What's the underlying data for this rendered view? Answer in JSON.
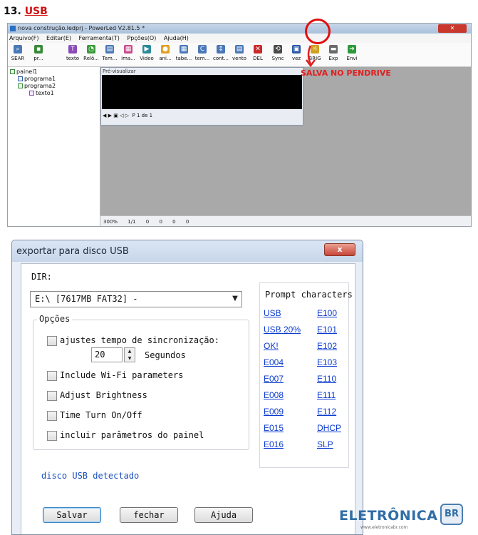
{
  "heading": {
    "number": "13.",
    "title": "USB"
  },
  "screenshot1": {
    "window_title": "nova construção.ledprj - PowerLed V2.81.5 *",
    "menu": [
      "Arquivo(F)",
      "Editar(E)",
      "Ferramenta(T)",
      "Ppções(O)",
      "Ajuda(H)"
    ],
    "toolbar": [
      "SEAR",
      "pr...",
      "texto",
      "Relô...",
      "Tem...",
      "ima...",
      "Video",
      "ani...",
      "tabe...",
      "tem...",
      "cont...",
      "vento",
      "DEL",
      "Sync",
      "vez",
      "BRIG",
      "Exp",
      "Envi"
    ],
    "tree": [
      "painel1",
      "programa1",
      "programa2",
      "texto1"
    ],
    "preview_title": "Pré-visualizar",
    "pager_text": "P 1 de 1",
    "status": [
      "300%",
      "1/1",
      "0",
      "0",
      "0",
      "0"
    ],
    "annotation": "SALVA NO PENDRIVE"
  },
  "dialog": {
    "title": "exportar para disco USB",
    "close_label": "x",
    "dir_label": "DIR:",
    "dir_value": "E:\\ [7617MB FAT32] -",
    "options_label": "Opções",
    "options": [
      {
        "label": "ajustes tempo de sincronização:",
        "checked": false
      },
      {
        "label": "Include Wi-Fi parameters",
        "checked": false
      },
      {
        "label": "Adjust Brightness",
        "checked": false
      },
      {
        "label": "Time Turn On/Off",
        "checked": false
      },
      {
        "label": "incluir parâmetros do painel",
        "checked": false
      }
    ],
    "sync_value": "20",
    "sync_unit": "Segundos",
    "prompt_title": "Prompt characters",
    "prompt_col1": [
      "USB",
      "USB 20%",
      "OK!",
      "E004",
      "E007",
      "E008",
      "E009",
      "E015",
      "E016"
    ],
    "prompt_col2": [
      "E100",
      "E101",
      "E102",
      "E103",
      "E110",
      "E111",
      "E112",
      "DHCP",
      "SLP"
    ],
    "status_text": "disco USB detectado",
    "buttons": {
      "save": "Salvar",
      "close": "fechar",
      "help": "Ajuda"
    }
  },
  "logo": {
    "text": "ELETRÔNICA",
    "badge": "BR",
    "url": "www.eletronicabr.com"
  },
  "colors": {
    "annotation": "#e02020",
    "link": "#0a3ad0",
    "logo": "#2f6ea7"
  }
}
